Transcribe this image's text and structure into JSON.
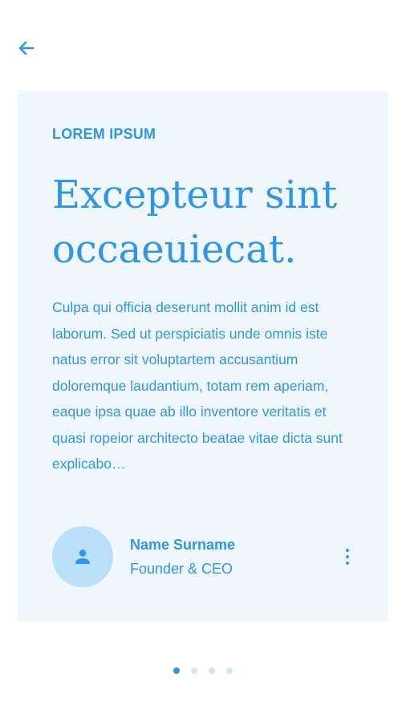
{
  "colors": {
    "accent": "#2f95e6",
    "card_background": "#eff7fd",
    "avatar_background": "#bcdff9",
    "dot_inactive": "#cfe8fb"
  },
  "header": {
    "back_icon": "arrow-left-icon"
  },
  "card": {
    "eyebrow": "LOREM IPSUM",
    "headline": "Excepteur sint occaeuiecat.",
    "body": "Culpa qui officia deserunt mollit anim id est laborum. Sed ut perspiciatis unde omnis iste natus error sit voluptartem accusantium doloremque laudantium, totam rem aperiam, eaque ipsa quae ab illo inventore veritatis et quasi ropeior architecto beatae vitae dicta sunt explicabo…",
    "author": {
      "avatar_icon": "user-icon",
      "name": "Name Surname",
      "role": "Founder & CEO",
      "menu_icon": "more-vertical-icon"
    }
  },
  "pager": {
    "total": 4,
    "active_index": 0
  }
}
